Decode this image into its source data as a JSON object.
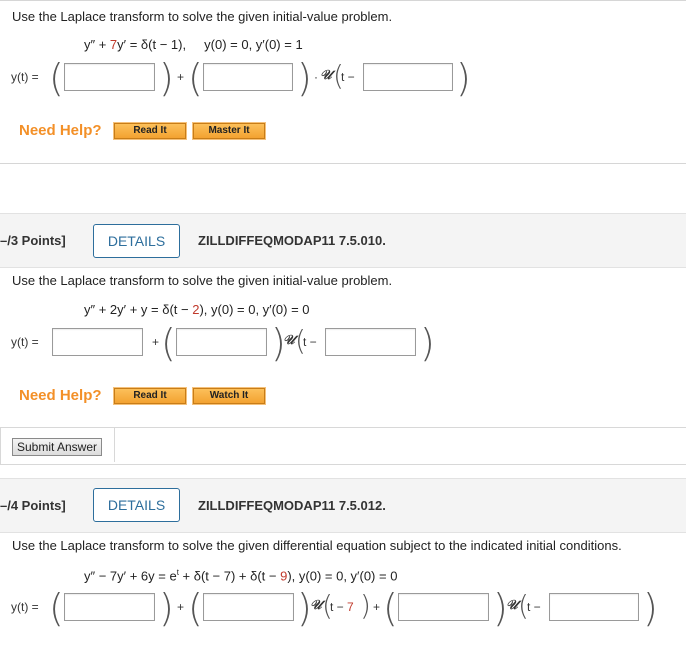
{
  "problem1": {
    "prompt": "Use the Laplace transform to solve the given initial-value problem.",
    "eq_lhs": "y″ + ",
    "eq_coef": "7",
    "eq_rest": "y′ = δ(t − 1),",
    "eq_ic": "y(0) = 0,   y′(0) = 1",
    "y_label": "y(t) =",
    "plus": "+",
    "dot": "·",
    "unit_step": "𝒰",
    "t_minus": "t −",
    "answer1": "",
    "answer2": "",
    "answer3": "",
    "need_help": "Need Help?",
    "btn_read": "Read It",
    "btn_master": "Master It"
  },
  "problem2": {
    "points": "–/3 Points]",
    "details": "DETAILS",
    "qid": "ZILLDIFFEQMODAP11 7.5.010.",
    "prompt": "Use the Laplace transform to solve the given initial-value problem.",
    "eq_a": "y″ + 2y′ + y = δ(t − ",
    "eq_red": "2",
    "eq_b": "),  y(0) = 0,  y′(0) = 0",
    "y_label": "y(t) =",
    "plus": "+",
    "unit_step": "𝒰",
    "t_minus": "t −",
    "answer1": "",
    "answer2": "",
    "answer3": "",
    "need_help": "Need Help?",
    "btn_read": "Read It",
    "btn_watch": "Watch It",
    "submit": "Submit Answer"
  },
  "problem3": {
    "points": "–/4 Points]",
    "details": "DETAILS",
    "qid": "ZILLDIFFEQMODAP11 7.5.012.",
    "prompt": "Use the Laplace transform to solve the given differential equation subject to the indicated initial conditions.",
    "eq_a": "y″ − 7y′ + 6y = e",
    "eq_sup": "t",
    "eq_b": " + δ(t − 7) + δ(t − ",
    "eq_red": "9",
    "eq_c": "),    y(0) = 0, y′(0) = 0",
    "y_label": "y(t) =",
    "plus": "+",
    "unit_step": "𝒰",
    "t_minus": "t −",
    "t_val": "7",
    "answer1": "",
    "answer2": "",
    "answer3": "",
    "answer4": ""
  },
  "colors": {
    "need_help": "#f39028",
    "button_orange": "#f3a230",
    "details_blue": "#2d6e9c",
    "highlight_red": "#c0392b"
  }
}
